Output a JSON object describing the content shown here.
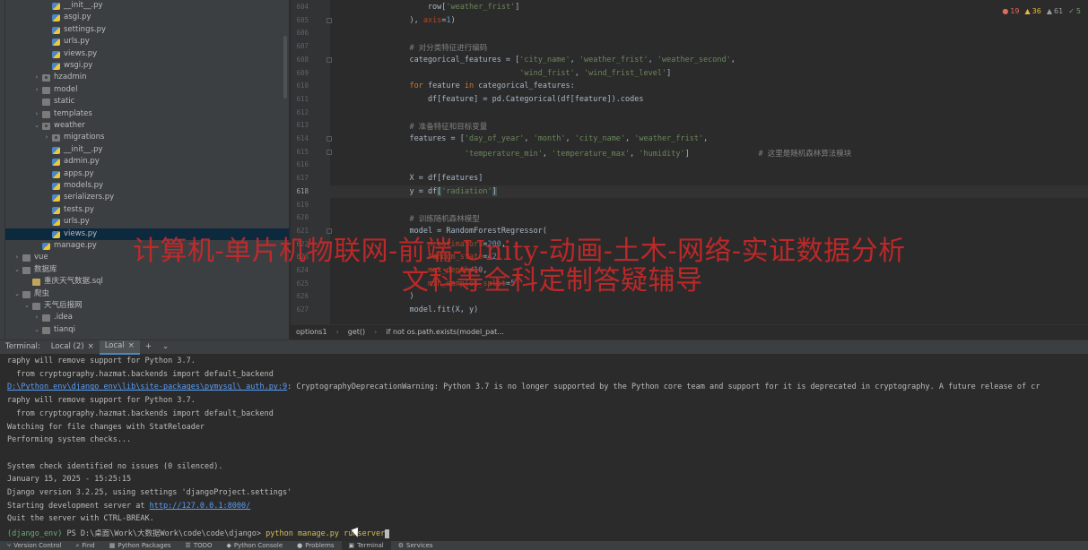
{
  "project_tree": {
    "items": [
      {
        "label": "__init__.py",
        "type": "py",
        "indent": 4,
        "arrow": ""
      },
      {
        "label": "asgi.py",
        "type": "py",
        "indent": 4,
        "arrow": ""
      },
      {
        "label": "settings.py",
        "type": "py",
        "indent": 4,
        "arrow": ""
      },
      {
        "label": "urls.py",
        "type": "py",
        "indent": 4,
        "arrow": ""
      },
      {
        "label": "views.py",
        "type": "py",
        "indent": 4,
        "arrow": ""
      },
      {
        "label": "wsgi.py",
        "type": "py",
        "indent": 4,
        "arrow": ""
      },
      {
        "label": "hzadmin",
        "type": "folder-pkg",
        "indent": 3,
        "arrow": "›"
      },
      {
        "label": "model",
        "type": "folder",
        "indent": 3,
        "arrow": "›"
      },
      {
        "label": "static",
        "type": "folder",
        "indent": 3,
        "arrow": ""
      },
      {
        "label": "templates",
        "type": "folder",
        "indent": 3,
        "arrow": "›"
      },
      {
        "label": "weather",
        "type": "folder-pkg",
        "indent": 3,
        "arrow": "⌄"
      },
      {
        "label": "migrations",
        "type": "folder-pkg",
        "indent": 4,
        "arrow": "›"
      },
      {
        "label": "__init__.py",
        "type": "py",
        "indent": 4,
        "arrow": ""
      },
      {
        "label": "admin.py",
        "type": "py",
        "indent": 4,
        "arrow": ""
      },
      {
        "label": "apps.py",
        "type": "py",
        "indent": 4,
        "arrow": ""
      },
      {
        "label": "models.py",
        "type": "py",
        "indent": 4,
        "arrow": ""
      },
      {
        "label": "serializers.py",
        "type": "py",
        "indent": 4,
        "arrow": ""
      },
      {
        "label": "tests.py",
        "type": "py",
        "indent": 4,
        "arrow": ""
      },
      {
        "label": "urls.py",
        "type": "py",
        "indent": 4,
        "arrow": ""
      },
      {
        "label": "views.py",
        "type": "py",
        "indent": 4,
        "arrow": "",
        "selected": true
      },
      {
        "label": "manage.py",
        "type": "py",
        "indent": 3,
        "arrow": ""
      },
      {
        "label": "vue",
        "type": "folder",
        "indent": 1,
        "arrow": "›"
      },
      {
        "label": "数据库",
        "type": "folder",
        "indent": 1,
        "arrow": "⌄"
      },
      {
        "label": "重庆天气数据.sql",
        "type": "sql",
        "indent": 2,
        "arrow": ""
      },
      {
        "label": "爬虫",
        "type": "folder",
        "indent": 1,
        "arrow": "⌄"
      },
      {
        "label": "天气后报网",
        "type": "folder",
        "indent": 2,
        "arrow": "⌄"
      },
      {
        "label": ".idea",
        "type": "folder",
        "indent": 3,
        "arrow": "›"
      },
      {
        "label": "tianqi",
        "type": "folder",
        "indent": 3,
        "arrow": "⌄"
      }
    ]
  },
  "editor": {
    "inspections": {
      "errors": "19",
      "warnings": "36",
      "weak": "61",
      "typos": "5"
    },
    "current_line": "618",
    "lines": [
      {
        "no": "604",
        "html": "<span>        row[</span><span class='str'>'weather_frist'</span><span>]</span>"
      },
      {
        "no": "605",
        "html": "<span>    ), </span><span class='param'>axis</span><span>=</span><span class='num'>1</span><span>)</span>"
      },
      {
        "no": "606",
        "html": ""
      },
      {
        "no": "607",
        "html": "<span class='cmt'>    # 对分类特征进行编码</span>"
      },
      {
        "no": "608",
        "html": "<span>    categorical_features = [</span><span class='str'>'city_name'</span><span>, </span><span class='str'>'weather_frist'</span><span>, </span><span class='str'>'weather_second'</span><span>,</span>"
      },
      {
        "no": "609",
        "html": "<span>                            </span><span class='str'>'wind_frist'</span><span>, </span><span class='str'>'wind_frist_level'</span><span>]</span>"
      },
      {
        "no": "610",
        "html": "<span class='kw'>    for </span><span>feature </span><span class='kw'>in </span><span>categorical_features:</span>"
      },
      {
        "no": "611",
        "html": "<span>        df[feature] = pd.Categorical(df[feature]).codes</span>"
      },
      {
        "no": "612",
        "html": ""
      },
      {
        "no": "613",
        "html": "<span class='cmt'>    # 准备特征和目标变量</span>"
      },
      {
        "no": "614",
        "html": "<span>    features = [</span><span class='str'>'day_of_year'</span><span>, </span><span class='str'>'month'</span><span>, </span><span class='str'>'city_name'</span><span>, </span><span class='str'>'weather_frist'</span><span>,</span>"
      },
      {
        "no": "615",
        "html": "<span>                </span><span class='str'>'temperature_min'</span><span>, </span><span class='str'>'temperature_max'</span><span>, </span><span class='str'>'humidity'</span><span>]               </span><span class='cmt'># 这里是随机森林算法模块</span>"
      },
      {
        "no": "616",
        "html": ""
      },
      {
        "no": "617",
        "html": "<span>    X = df[features]</span>"
      },
      {
        "no": "618",
        "html": "<span>    y = df</span><span class='hl-bg'>[</span><span class='str'>'radiation'</span><span class='hl-bg'>]</span>"
      },
      {
        "no": "619",
        "html": ""
      },
      {
        "no": "620",
        "html": "<span class='cmt'>    # 训练随机森林模型</span>"
      },
      {
        "no": "621",
        "html": "<span>    model = RandomForestRegressor(</span>"
      },
      {
        "no": "622",
        "html": "<span>        </span><span class='param'>n_estimators</span><span>=</span><span class='num'>200</span><span>,</span>"
      },
      {
        "no": "623",
        "html": "<span>        </span><span class='param'>random_state</span><span>=</span><span class='num'>42</span><span>,</span>"
      },
      {
        "no": "624",
        "html": "<span>        </span><span class='param'>max_depth</span><span>=</span><span class='num'>10</span><span>,</span>"
      },
      {
        "no": "625",
        "html": "<span>        </span><span class='param'>min_samples_split</span><span>=</span><span class='num'>5</span>"
      },
      {
        "no": "626",
        "html": "<span>    )</span>"
      },
      {
        "no": "627",
        "html": "<span>    model.fit(X, y)</span>"
      }
    ]
  },
  "breadcrumb": [
    "options1",
    "get()",
    "if not os.path.exists(model_pat..."
  ],
  "terminal": {
    "title": "Terminal:",
    "tabs": [
      {
        "label": "Local (2)"
      },
      {
        "label": "Local",
        "active": true
      }
    ],
    "add_label": "+",
    "menu_label": "⌄",
    "lines": [
      {
        "text": "raphy will remove support for Python 3.7."
      },
      {
        "text": "  from cryptography.hazmat.backends import default_backend"
      },
      {
        "link": "D:\\Python_env\\django_env\\lib\\site-packages\\pymysql\\_auth.py:9",
        "text": ": CryptographyDeprecationWarning: Python 3.7 is no longer supported by the Python core team and support for it is deprecated in cryptography. A future release of cr"
      },
      {
        "text": "raphy will remove support for Python 3.7."
      },
      {
        "text": "  from cryptography.hazmat.backends import default_backend"
      },
      {
        "text": "Watching for file changes with StatReloader"
      },
      {
        "text": "Performing system checks..."
      },
      {
        "text": ""
      },
      {
        "text": "System check identified no issues (0 silenced)."
      },
      {
        "text": "January 15, 2025 - 15:25:15"
      },
      {
        "text": "Django version 3.2.25, using settings 'djangoProject.settings'"
      },
      {
        "text": "Starting development server at ",
        "link2": "http://127.0.0.1:8000/"
      },
      {
        "text": "Quit the server with CTRL-BREAK."
      },
      {
        "env": "(django_env)",
        "prompt": " PS D:\\桌面\\Work\\大数据Work\\code\\code\\django> ",
        "cmd": "python manage.py runserver"
      }
    ]
  },
  "status_bar": {
    "items": [
      {
        "label": "Version Control",
        "icon": "branch-icon"
      },
      {
        "label": "Find",
        "icon": "search-icon"
      },
      {
        "label": "Python Packages",
        "icon": "package-icon"
      },
      {
        "label": "TODO",
        "icon": "list-icon"
      },
      {
        "label": "Python Console",
        "icon": "python-icon"
      },
      {
        "label": "Problems",
        "icon": "warning-icon"
      },
      {
        "label": "Terminal",
        "icon": "terminal-icon",
        "active": true
      },
      {
        "label": "Services",
        "icon": "services-icon"
      }
    ]
  },
  "watermark": {
    "line1": "计算机-单片机物联网-前端-Unity-动画-土木-网络-实证数据分析",
    "line2": "文科等全科定制答疑辅导"
  }
}
